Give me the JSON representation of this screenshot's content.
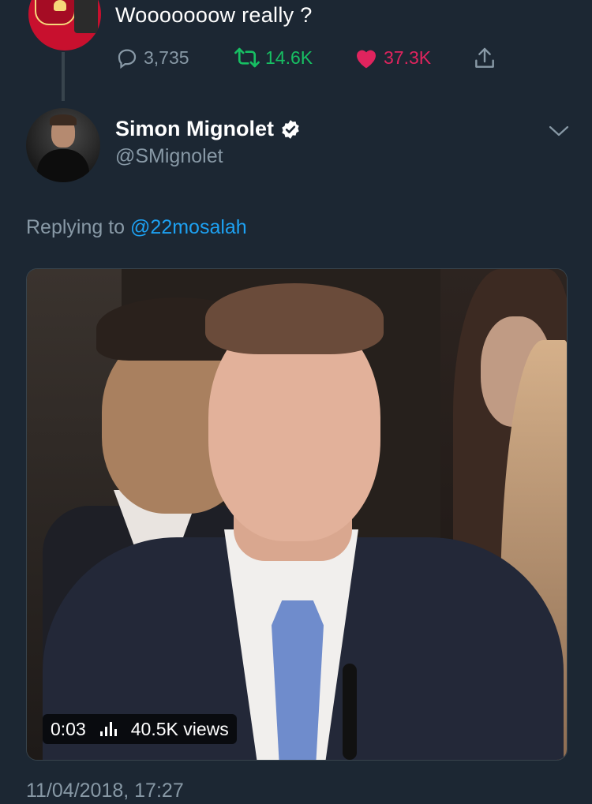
{
  "top_tweet": {
    "text": "Wooooooow really ?",
    "reply_count": "3,735",
    "retweet_count": "14.6K",
    "like_count": "37.3K",
    "icons": {
      "reply": "reply-icon",
      "retweet": "retweet-icon",
      "like": "heart-icon",
      "share": "share-icon"
    }
  },
  "reply_tweet": {
    "display_name": "Simon Mignolet",
    "handle": "@SMignolet",
    "verified": true,
    "replying_prefix": "Replying to",
    "replying_mention": "@22mosalah",
    "media": {
      "duration": "0:03",
      "views": "40.5K views"
    },
    "timestamp": "11/04/2018, 17:27"
  },
  "colors": {
    "background": "#1c2733",
    "secondary_text": "#8899a6",
    "retweet": "#17bf63",
    "like": "#e0245e",
    "link": "#1da1f2"
  }
}
